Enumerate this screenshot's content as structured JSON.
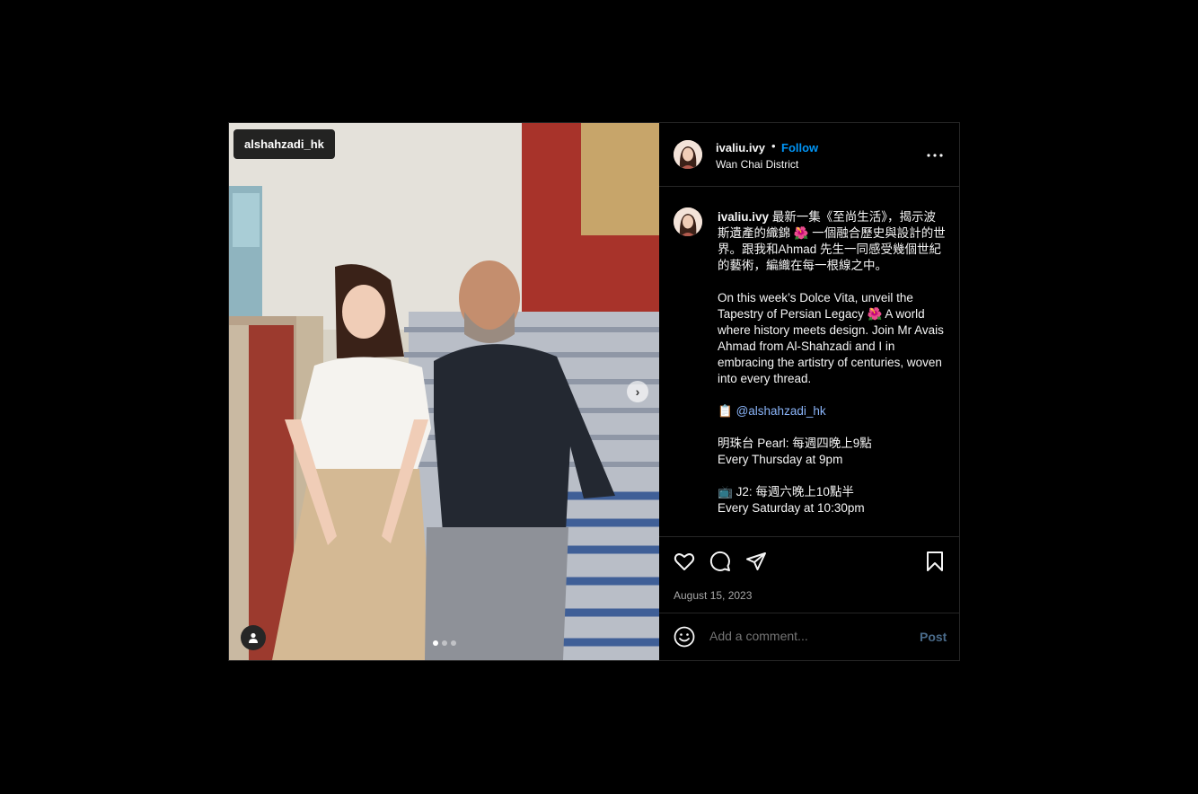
{
  "media": {
    "tag_username": "alshahzadi_hk",
    "carousel_count": 3,
    "carousel_active": 1
  },
  "header": {
    "username": "ivaliu.ivy",
    "separator": "•",
    "follow_label": "Follow",
    "location": "Wan Chai District"
  },
  "caption": {
    "username": "ivaliu.ivy",
    "text_zh": "最新一集《至尚生活》，揭示波斯遺產的織錦 🌺 一個融合歷史與設計的世界。跟我和Ahmad 先生一同感受幾個世紀的藝術，編織在每一根線之中。",
    "text_en": "On this week’s Dolce Vita, unveil the Tapestry of Persian Legacy 🌺 A world where history meets design. Join Mr Avais Ahmad from Al-Shahzadi and I in embracing the artistry of centuries, woven into every thread.",
    "mention_icon": "📋",
    "mention": "@alshahzadi_hk",
    "schedule1_zh": "明珠台 Pearl: 每週四晚上9點",
    "schedule1_en": "Every Thursday at 9pm",
    "schedule2_icon": "📺",
    "schedule2_zh": "J2: 每週六晚上10點半",
    "schedule2_en": "Every Saturday at 10:30pm"
  },
  "actions": {
    "icons": [
      "heart-icon",
      "comment-icon",
      "share-icon",
      "bookmark-icon"
    ],
    "date": "August 15, 2023"
  },
  "comment": {
    "placeholder": "Add a comment...",
    "post_label": "Post"
  },
  "colors": {
    "background": "#000000",
    "follow": "#0095f6",
    "mention": "#8ab4f8",
    "muted": "#a8a8a8",
    "post_disabled": "#4a6b8a"
  }
}
